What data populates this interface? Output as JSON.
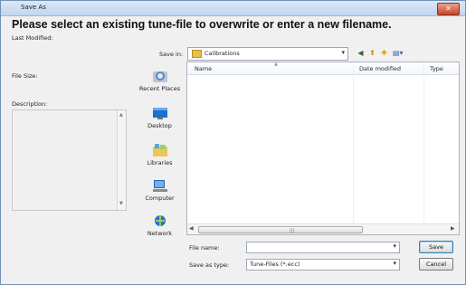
{
  "window": {
    "title": "Save As",
    "close_glyph": "✕"
  },
  "heading": "Please select an existing tune-file to overwrite or enter a new filename.",
  "info": {
    "last_modified_label": "Last Modified:",
    "file_size_label": "File Size:",
    "description_label": "Description:"
  },
  "save_in": {
    "label": "Save in:",
    "value": "Calibrations"
  },
  "places": [
    {
      "label": "Recent Places",
      "icon": "recent-places-icon"
    },
    {
      "label": "Desktop",
      "icon": "desktop-icon"
    },
    {
      "label": "Libraries",
      "icon": "libraries-icon"
    },
    {
      "label": "Computer",
      "icon": "computer-icon"
    },
    {
      "label": "Network",
      "icon": "network-icon"
    }
  ],
  "columns": {
    "name": "Name",
    "date_modified": "Date modified",
    "type": "Type"
  },
  "file_name": {
    "label": "File name:",
    "value": ""
  },
  "save_as_type": {
    "label": "Save as type:",
    "value": "Tune-Files (*.ecc)"
  },
  "buttons": {
    "save": "Save",
    "cancel": "Cancel"
  },
  "toolbar": [
    "back-icon",
    "up-folder-icon",
    "new-folder-icon",
    "views-menu-icon"
  ]
}
